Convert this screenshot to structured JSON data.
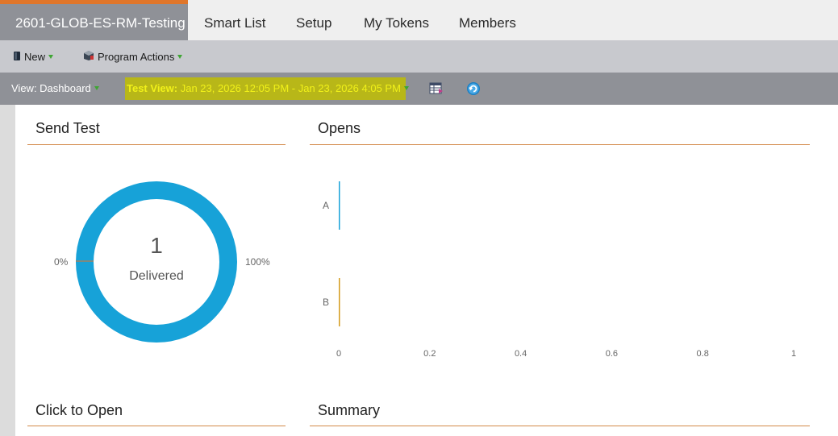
{
  "tabs": {
    "program": "2601-GLOB-ES-RM-Testing",
    "smart_list": "Smart List",
    "setup": "Setup",
    "my_tokens": "My Tokens",
    "members": "Members"
  },
  "toolbar": {
    "new_label": "New",
    "program_actions_label": "Program Actions"
  },
  "viewbar": {
    "view_label": "View: Dashboard",
    "test_view_prefix": "Test View:",
    "test_view_range": "Jan 23, 2026 12:05 PM - Jan 23, 2026 4:05 PM"
  },
  "send_test": {
    "title": "Send Test",
    "count": "1",
    "center_label": "Delivered",
    "left_pct": "0%",
    "right_pct": "100%",
    "ring_color": "#17a2d8",
    "delivered_fraction": 1.0
  },
  "opens": {
    "title": "Opens",
    "chart_data": {
      "type": "bar",
      "orientation": "horizontal",
      "categories": [
        "A",
        "B"
      ],
      "values": [
        0,
        0
      ],
      "colors": [
        "#17a2d8",
        "#d49a1b"
      ],
      "xlim": [
        0,
        1
      ],
      "xticks": [
        "0",
        "0.2",
        "0.4",
        "0.6",
        "0.8",
        "1"
      ]
    }
  },
  "click_to_open": {
    "title": "Click to Open"
  },
  "summary": {
    "title": "Summary"
  },
  "colors": {
    "accent_orange": "#e0762a",
    "rule_orange": "#d38a49",
    "highlight": "#b8b718"
  }
}
